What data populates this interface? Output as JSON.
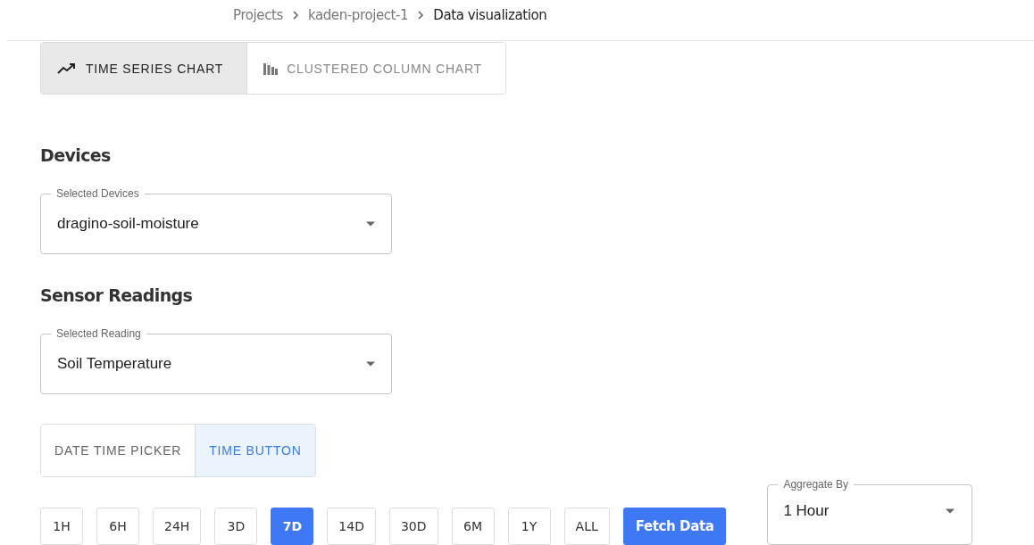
{
  "breadcrumb": [
    {
      "label": "Projects",
      "current": false
    },
    {
      "label": "kaden-project-1",
      "current": false
    },
    {
      "label": "Data visualization",
      "current": true
    }
  ],
  "chart_tabs": [
    {
      "label": "TIME SERIES CHART",
      "kind": "line",
      "selected": true
    },
    {
      "label": "CLUSTERED COLUMN CHART",
      "kind": "columns",
      "selected": false
    }
  ],
  "devices": {
    "heading": "Devices",
    "label": "Selected Devices",
    "value": "dragino-soil-moisture"
  },
  "sensor_readings": {
    "heading": "Sensor Readings",
    "label": "Selected Reading",
    "value": "Soil Temperature"
  },
  "time_modes": [
    {
      "label": "DATE TIME PICKER",
      "selected": false
    },
    {
      "label": "TIME BUTTON",
      "selected": true
    }
  ],
  "ranges": [
    {
      "label": "1H",
      "selected": false
    },
    {
      "label": "6H",
      "selected": false
    },
    {
      "label": "24H",
      "selected": false
    },
    {
      "label": "3D",
      "selected": false
    },
    {
      "label": "7D",
      "selected": true
    },
    {
      "label": "14D",
      "selected": false
    },
    {
      "label": "30D",
      "selected": false
    },
    {
      "label": "6M",
      "selected": false
    },
    {
      "label": "1Y",
      "selected": false
    },
    {
      "label": "ALL",
      "selected": false
    }
  ],
  "fetch_button": "Fetch Data",
  "aggregate": {
    "label": "Aggregate By",
    "value": "1 Hour"
  }
}
